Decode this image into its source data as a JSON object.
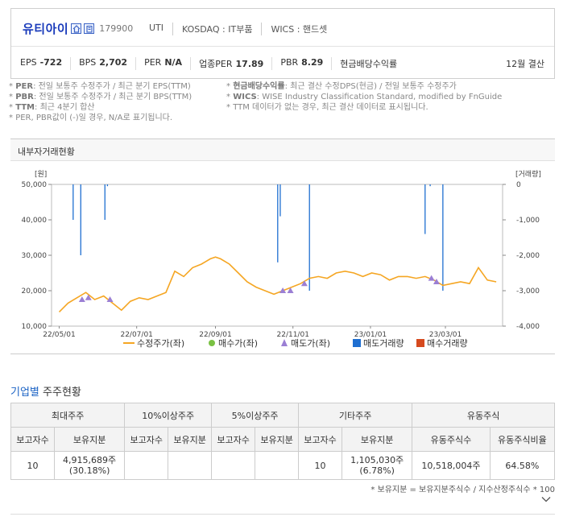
{
  "company": {
    "name": "유티아이",
    "code": "179900",
    "ticker": "UTI",
    "market": "KOSDAQ : IT부품",
    "wics": "WICS : 핸드셋"
  },
  "metrics": [
    {
      "label": "EPS",
      "value": "-722"
    },
    {
      "label": "BPS",
      "value": "2,702"
    },
    {
      "label": "PER",
      "value": "N/A"
    },
    {
      "label": "업종PER",
      "value": "17.89"
    },
    {
      "label": "PBR",
      "value": "8.29"
    },
    {
      "label": "현금배당수익률",
      "value": ""
    }
  ],
  "fiscal": "12월 결산",
  "notes": {
    "left": [
      {
        "key": "PER",
        "text": ": 전일 보통주 수정주가 / 최근 분기 EPS(TTM)"
      },
      {
        "key": "PBR",
        "text": ": 전일 보통주 수정주가 / 최근 분기 BPS(TTM)"
      },
      {
        "key": "TTM",
        "text": ": 최근 4분기 합산"
      },
      {
        "key": "",
        "text": "PER, PBR값이 (-)일 경우, N/A로 표기됩니다."
      }
    ],
    "right": [
      {
        "key": "현금배당수익률",
        "text": ": 최근 결산 수정DPS(현금) / 전일 보통주 수정주가"
      },
      {
        "key": "WICS",
        "text": ": WISE Industry Classification Standard, modified by FnGuide"
      },
      {
        "key": "",
        "text": "TTM 데이터가 없는 경우, 최근 결산 데이터로 표시됩니다."
      }
    ]
  },
  "chart_title": "내부자거래현황",
  "chart_data": {
    "type": "line",
    "left_unit": "[원]",
    "right_unit": "[거래량]",
    "y_left_ticks": [
      "50,000",
      "40,000",
      "30,000",
      "20,000",
      "10,000"
    ],
    "y_left_range": [
      10000,
      50000
    ],
    "y_right_ticks": [
      "0",
      "-1,000",
      "-2,000",
      "-3,000",
      "-4,000"
    ],
    "y_right_range": [
      -4000,
      0
    ],
    "x_ticks": [
      "22/05/01",
      "22/07/01",
      "22/09/01",
      "22/11/01",
      "23/01/01",
      "23/03/01"
    ],
    "x_range": [
      "2022-04-25",
      "2023-04-15"
    ],
    "price_series": [
      [
        "2022-05-01",
        14000
      ],
      [
        "2022-05-08",
        16500
      ],
      [
        "2022-05-15",
        18000
      ],
      [
        "2022-05-22",
        19500
      ],
      [
        "2022-05-29",
        17500
      ],
      [
        "2022-06-05",
        18500
      ],
      [
        "2022-06-12",
        16500
      ],
      [
        "2022-06-19",
        14500
      ],
      [
        "2022-06-26",
        17000
      ],
      [
        "2022-07-03",
        18000
      ],
      [
        "2022-07-10",
        17500
      ],
      [
        "2022-07-17",
        18500
      ],
      [
        "2022-07-24",
        19500
      ],
      [
        "2022-07-31",
        25500
      ],
      [
        "2022-08-07",
        24000
      ],
      [
        "2022-08-14",
        26500
      ],
      [
        "2022-08-21",
        27500
      ],
      [
        "2022-08-28",
        29000
      ],
      [
        "2022-09-01",
        29500
      ],
      [
        "2022-09-05",
        29000
      ],
      [
        "2022-09-12",
        27500
      ],
      [
        "2022-09-19",
        25000
      ],
      [
        "2022-09-26",
        22500
      ],
      [
        "2022-10-03",
        21000
      ],
      [
        "2022-10-10",
        20000
      ],
      [
        "2022-10-17",
        19000
      ],
      [
        "2022-10-24",
        20000
      ],
      [
        "2022-10-31",
        21000
      ],
      [
        "2022-11-07",
        22000
      ],
      [
        "2022-11-14",
        23500
      ],
      [
        "2022-11-21",
        24000
      ],
      [
        "2022-11-28",
        23500
      ],
      [
        "2022-12-05",
        25000
      ],
      [
        "2022-12-12",
        25500
      ],
      [
        "2022-12-19",
        25000
      ],
      [
        "2022-12-26",
        24000
      ],
      [
        "2023-01-02",
        25000
      ],
      [
        "2023-01-09",
        24500
      ],
      [
        "2023-01-16",
        23000
      ],
      [
        "2023-01-23",
        24000
      ],
      [
        "2023-01-30",
        24000
      ],
      [
        "2023-02-06",
        23500
      ],
      [
        "2023-02-13",
        24000
      ],
      [
        "2023-02-20",
        23000
      ],
      [
        "2023-02-27",
        21500
      ],
      [
        "2023-03-06",
        22000
      ],
      [
        "2023-03-13",
        22500
      ],
      [
        "2023-03-20",
        22000
      ],
      [
        "2023-03-27",
        26500
      ],
      [
        "2023-04-03",
        23000
      ],
      [
        "2023-04-10",
        22500
      ]
    ],
    "sell_markers": [
      [
        "2022-05-19",
        17500
      ],
      [
        "2022-05-24",
        18000
      ],
      [
        "2022-06-10",
        17500
      ],
      [
        "2022-10-24",
        20000
      ],
      [
        "2022-10-30",
        20000
      ],
      [
        "2022-11-10",
        22000
      ],
      [
        "2023-02-18",
        23500
      ],
      [
        "2023-02-22",
        22500
      ]
    ],
    "sell_volume": [
      [
        "2022-05-12",
        -1000
      ],
      [
        "2022-05-18",
        -2000
      ],
      [
        "2022-06-06",
        -1000
      ],
      [
        "2022-06-08",
        -50
      ],
      [
        "2022-10-20",
        -2200
      ],
      [
        "2022-10-22",
        -900
      ],
      [
        "2022-11-14",
        -3000
      ],
      [
        "2023-02-13",
        -1400
      ],
      [
        "2023-02-17",
        -50
      ],
      [
        "2023-02-27",
        -3000
      ]
    ],
    "legend": [
      {
        "name": "수정주가(좌)",
        "color": "#f5a623",
        "kind": "line"
      },
      {
        "name": "매수가(좌)",
        "color": "#7ac143",
        "kind": "dot"
      },
      {
        "name": "매도가(좌)",
        "color": "#9b7fd4",
        "kind": "triangle"
      },
      {
        "name": "매도거래량",
        "color": "#1f6fd1",
        "kind": "square"
      },
      {
        "name": "매수거래량",
        "color": "#d64a1f",
        "kind": "square"
      }
    ]
  },
  "section2": {
    "bold": "기업별",
    "rest": "주주현황"
  },
  "shareholders": {
    "groups": [
      "최대주주",
      "10%이상주주",
      "5%이상주주",
      "기타주주",
      "유동주식"
    ],
    "subheaders": [
      "보고자수",
      "보유지분",
      "보고자수",
      "보유지분",
      "보고자수",
      "보유지분",
      "보고자수",
      "보유지분",
      "유동주식수",
      "유동주식비율"
    ],
    "row": [
      "10",
      "4,915,689주\n(30.18%)",
      "",
      "",
      "",
      "",
      "10",
      "1,105,030주\n(6.78%)",
      "10,518,004주",
      "64.58%"
    ]
  },
  "footnote": "* 보유지분 = 보유지분주식수 / 지수산정주식수 * 100"
}
